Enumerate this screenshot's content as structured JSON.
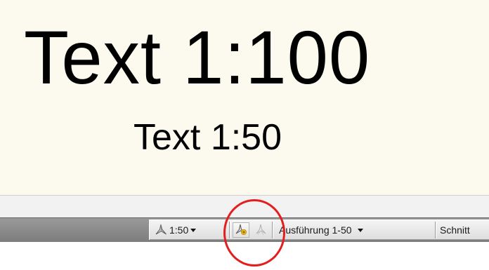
{
  "drawing": {
    "large_text": "Text 1:100",
    "small_text": "Text 1:50"
  },
  "status_bar": {
    "annotation_scale": "1:50",
    "annotation_scale_icon": "annotation-scale-icon",
    "add_scale_button_icon": "add-scale-to-objects-icon",
    "remove_scale_button_icon": "remove-scale-icon",
    "visual_style": "Ausführung 1-50",
    "next_item": "Schnitt"
  },
  "colors": {
    "canvas_background": "#fcfaee",
    "status_bar": "#8c8c8c",
    "highlight_circle": "#e41e1e"
  }
}
